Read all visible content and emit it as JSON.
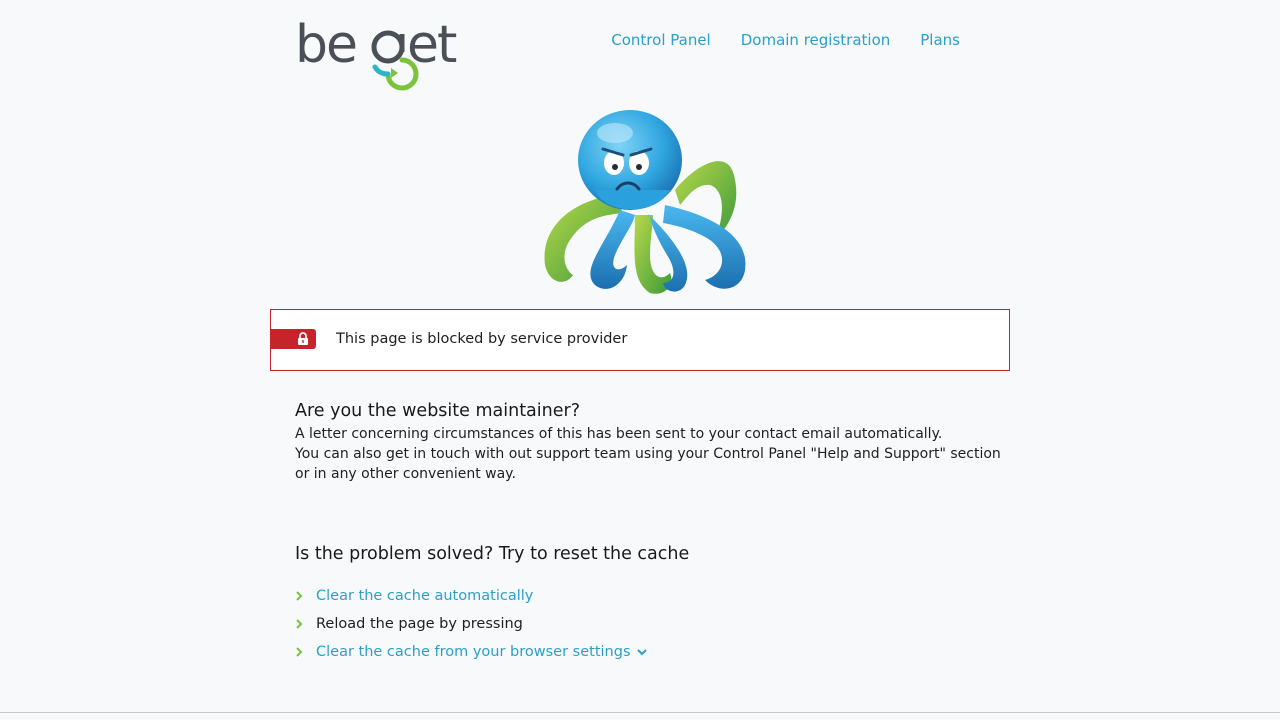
{
  "brand": {
    "name": "beget",
    "gray": "#4b4f58",
    "green": "#7ac33a",
    "teal": "#2fb5c6"
  },
  "nav": {
    "items": [
      {
        "label": "Control Panel"
      },
      {
        "label": "Domain registration"
      },
      {
        "label": "Plans"
      }
    ]
  },
  "alert": {
    "message": "This page is blocked by service provider",
    "color": "#c6242b",
    "icon": "lock-icon"
  },
  "maintainer": {
    "title": "Are you the website maintainer?",
    "lines": [
      "A letter concerning circumstances of this has been sent to your contact email automatically.",
      "You can also get in touch with out support team using your Control Panel \"Help and Support\" section",
      "or in any other convenient way."
    ]
  },
  "cache": {
    "title": "Is the problem solved? Try to reset the cache",
    "steps": [
      {
        "label": "Clear the cache automatically",
        "link": true
      },
      {
        "label": "Reload the page by pressing",
        "link": false
      },
      {
        "label": "Clear the cache from your browser settings",
        "link": true,
        "dropdown": true
      }
    ]
  },
  "colors": {
    "link": "#2aa0c8",
    "chevron": "#7ac33a",
    "background": "#f7f9fb"
  }
}
